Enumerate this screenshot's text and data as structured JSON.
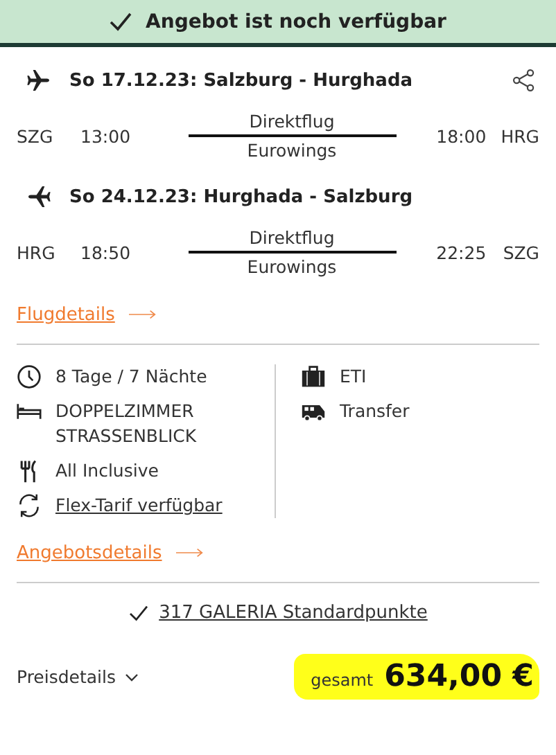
{
  "banner": {
    "text": "Angebot ist noch verfügbar"
  },
  "flights": [
    {
      "kind": "outbound",
      "title": "So 17.12.23: Salzburg - Hurghada",
      "from": "SZG",
      "dep": "13:00",
      "type": "Direktflug",
      "airline": "Eurowings",
      "arr": "18:00",
      "to": "HRG"
    },
    {
      "kind": "return",
      "title": "So 24.12.23: Hurghada - Salzburg",
      "from": "HRG",
      "dep": "18:50",
      "type": "Direktflug",
      "airline": "Eurowings",
      "arr": "22:25",
      "to": "SZG"
    }
  ],
  "flight_details_link": "Flugdetails",
  "features_left": [
    {
      "kind": "duration",
      "text": "8 Tage / 7 Nächte",
      "link": false
    },
    {
      "kind": "room",
      "text": "DOPPELZIMMER STRASSENBLICK",
      "link": false
    },
    {
      "kind": "board",
      "text": "All Inclusive",
      "link": false
    },
    {
      "kind": "flex",
      "text": "Flex-Tarif verfügbar",
      "link": true
    }
  ],
  "features_right": [
    {
      "kind": "operator",
      "text": "ETI"
    },
    {
      "kind": "transfer",
      "text": "Transfer"
    }
  ],
  "offer_details_link": "Angebotsdetails",
  "points": "317 GALERIA Standardpunkte",
  "price_details": "Preisdetails",
  "total_label": "gesamt",
  "total": "634,00 €"
}
